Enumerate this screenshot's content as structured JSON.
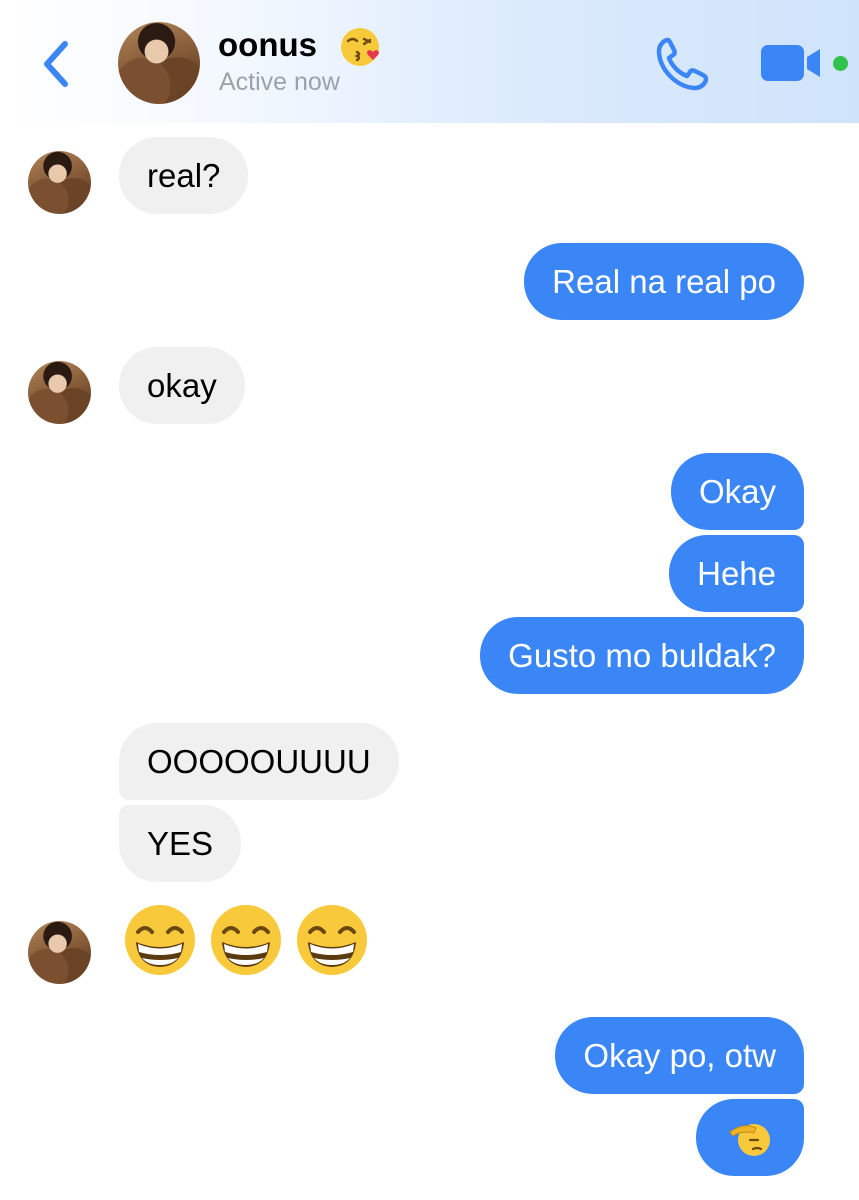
{
  "header": {
    "contact_name": "oonus",
    "name_emoji": "kissing-face-with-heart-emoji",
    "status": "Active now",
    "icons": {
      "back": "chevron-left-icon",
      "call": "phone-icon",
      "video": "video-camera-icon"
    },
    "accent_color": "#3b86f7",
    "online_color": "#31c24d"
  },
  "messages": [
    {
      "from": "them",
      "text": "real?"
    },
    {
      "from": "me",
      "text": "Real na real po"
    },
    {
      "from": "them",
      "text": "okay"
    },
    {
      "from": "me",
      "text": "Okay"
    },
    {
      "from": "me",
      "text": "Hehe"
    },
    {
      "from": "me",
      "text": "Gusto mo buldak?"
    },
    {
      "from": "them",
      "text": "OOOOOUUUU"
    },
    {
      "from": "them",
      "text": "YES"
    },
    {
      "from": "them",
      "emoji": [
        "grinning-face-emoji",
        "grinning-face-emoji",
        "grinning-face-emoji"
      ]
    },
    {
      "from": "me",
      "text": "Okay po, otw"
    },
    {
      "from": "me",
      "emoji": [
        "saluting-face-emoji"
      ]
    }
  ],
  "colors": {
    "incoming_bubble": "#f0f0f0",
    "outgoing_bubble": "#3b86f7"
  }
}
